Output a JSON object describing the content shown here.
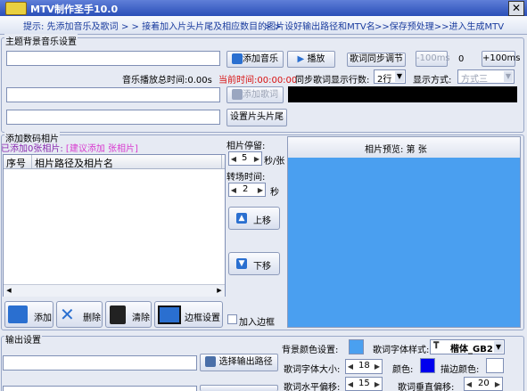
{
  "title": "MTV制作圣手10.0",
  "steps": {
    "s1": "提示: 先添加音乐及歌词",
    "s2": "> > 接着加入片头片尾及相应数目的图片",
    "s3": "> > 设好输出路径和MTV名",
    "s4": ">>保存预处理>>进入生成MTV"
  },
  "music": {
    "group_label": "主题背景音乐设置",
    "add_music": "添加音乐",
    "play": "播放",
    "lyric_sync": "歌词同步调节",
    "minus_100": "-100ms",
    "offset": "0",
    "plus_100": "+100ms",
    "total_time_label": "音乐播放总时间:0.00s",
    "current_time_label": "当前时间:00:00:00",
    "add_lyrics": "添加歌词",
    "sync_rows_label": "同步歌词显示行数:",
    "sync_rows_value": "2行",
    "display_mode_label": "显示方式:",
    "display_mode_value": "方式三",
    "set_intro": "设置片头片尾"
  },
  "photos": {
    "group_label": "添加数码相片",
    "added_prefix": "已添加0张相片:",
    "suggest": "[建议添加 张相片]",
    "col_index": "序号",
    "col_path": "相片路径及相片名",
    "stay_label": "相片停留:",
    "stay_value": "5",
    "stay_unit": "秒/张",
    "transition_label": "转场时间:",
    "transition_value": "2",
    "transition_unit": "秒",
    "up": "上移",
    "down": "下移",
    "preview": "相片预览: 第  张",
    "add": "添加",
    "delete": "删除",
    "clear": "清除",
    "border_settings": "边框设置",
    "add_border": "加入边框"
  },
  "output": {
    "group_label": "输出设置",
    "choose_path": "选择输出路径",
    "bg_color_label": "背景颜色设置:",
    "lyric_font_label": "歌词字体样式:",
    "lyric_font_value": "楷体_GB2",
    "lyric_size_label": "歌词字体大小:",
    "lyric_size_value": "18",
    "color_label": "颜色:",
    "stroke_color_label": "描边颜色:",
    "h_offset_label": "歌词水平偏移:",
    "h_offset_value": "15",
    "v_offset_label": "歌词垂直偏移:",
    "v_offset_value": "20"
  },
  "colors": {
    "preview_blue": "#4a9ff0",
    "bg_color": "#4aa0f0",
    "font_color": "#0000ee",
    "stroke_color": "#ffffff"
  }
}
